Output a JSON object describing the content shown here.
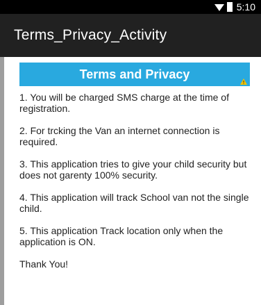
{
  "status_bar": {
    "time": "5:10"
  },
  "action_bar": {
    "title": "Terms_Privacy_Activity"
  },
  "header": {
    "title": "Terms and Privacy"
  },
  "terms": [
    "1. You will be charged SMS charge at the time of registration.",
    " 2. For trcking the Van an internet connection is required.",
    " 3. This application tries to give your child security but does not garenty 100% security.",
    "4. This application will track School van not the single child.",
    " 5. This application Track location only when the application is ON."
  ],
  "closing": "Thank You!",
  "colors": {
    "header_bg": "#29a9df",
    "action_bar_bg": "#212121",
    "status_bar_bg": "#000000"
  },
  "icons": {
    "wifi": "wifi-icon",
    "battery": "battery-icon",
    "warning": "warning-icon"
  }
}
